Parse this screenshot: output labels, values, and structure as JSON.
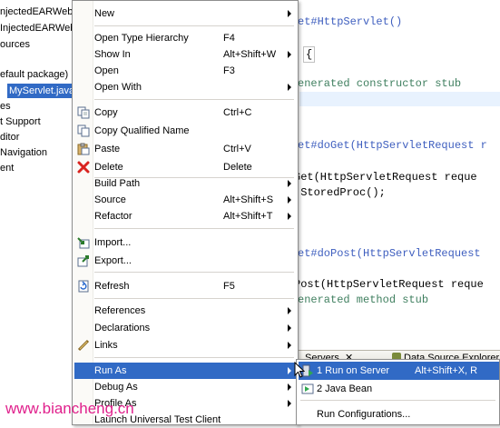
{
  "explorer": {
    "rows": [
      "njectedEARWeb",
      "InjectedEARWeb",
      "ources",
      "efault package)",
      "MyServlet.java",
      "es",
      "t Support",
      "ditor",
      "Navigation",
      "ent"
    ]
  },
  "editor": {
    "lines": [
      "et#HttpServlet()",
      "{",
      "enerated constructor stub",
      "et#doGet(HttpServletRequest r",
      "Get(HttpServletRequest reque",
      ".StoredProc();",
      "et#doPost(HttpServletRequest",
      "Post(HttpServletRequest reque",
      "enerated method stub"
    ]
  },
  "panel": {
    "tabs": [
      "Servers",
      "Data Source Explorer"
    ]
  },
  "context_menu": {
    "items": [
      {
        "label": "New",
        "accel": "",
        "submenu": true,
        "icon": ""
      },
      {
        "label": "Open Type Hierarchy",
        "accel": "F4",
        "submenu": false,
        "icon": ""
      },
      {
        "label": "Show In",
        "accel": "Alt+Shift+W",
        "submenu": true,
        "icon": ""
      },
      {
        "label": "Open",
        "accel": "F3",
        "submenu": false,
        "icon": ""
      },
      {
        "label": "Open With",
        "accel": "",
        "submenu": true,
        "icon": ""
      },
      {
        "label": "Copy",
        "accel": "Ctrl+C",
        "submenu": false,
        "icon": "copy-icon"
      },
      {
        "label": "Copy Qualified Name",
        "accel": "",
        "submenu": false,
        "icon": "copy-qualified-icon"
      },
      {
        "label": "Paste",
        "accel": "Ctrl+V",
        "submenu": false,
        "icon": "paste-icon"
      },
      {
        "label": "Delete",
        "accel": "Delete",
        "submenu": false,
        "icon": "delete-icon"
      },
      {
        "label": "Build Path",
        "accel": "",
        "submenu": true,
        "icon": ""
      },
      {
        "label": "Source",
        "accel": "Alt+Shift+S",
        "submenu": true,
        "icon": ""
      },
      {
        "label": "Refactor",
        "accel": "Alt+Shift+T",
        "submenu": true,
        "icon": ""
      },
      {
        "label": "Import...",
        "accel": "",
        "submenu": false,
        "icon": "import-icon"
      },
      {
        "label": "Export...",
        "accel": "",
        "submenu": false,
        "icon": "export-icon"
      },
      {
        "label": "Refresh",
        "accel": "F5",
        "submenu": false,
        "icon": "refresh-icon"
      },
      {
        "label": "References",
        "accel": "",
        "submenu": true,
        "icon": ""
      },
      {
        "label": "Declarations",
        "accel": "",
        "submenu": true,
        "icon": ""
      },
      {
        "label": "Links",
        "accel": "",
        "submenu": true,
        "icon": "links-icon"
      },
      {
        "label": "Run As",
        "accel": "",
        "submenu": true,
        "icon": ""
      },
      {
        "label": "Debug As",
        "accel": "",
        "submenu": true,
        "icon": ""
      },
      {
        "label": "Profile As",
        "accel": "",
        "submenu": true,
        "icon": ""
      },
      {
        "label": "Launch Universal Test Client",
        "accel": "",
        "submenu": false,
        "icon": ""
      }
    ]
  },
  "run_as_submenu": {
    "items": [
      {
        "label": "1 Run on Server",
        "accel": "Alt+Shift+X, R",
        "icon": "server-run-icon"
      },
      {
        "label": "2 Java Bean",
        "accel": "",
        "icon": "java-bean-icon"
      },
      {
        "label": "Run Configurations...",
        "accel": "",
        "icon": ""
      }
    ]
  },
  "watermark": "www.biancheng.cn",
  "colors": {
    "selection": "#316ac5",
    "keyword": "#7f0055",
    "comment": "#3f7f5f",
    "javadoc": "#3f5fbf",
    "watermark": "#e0208c"
  }
}
